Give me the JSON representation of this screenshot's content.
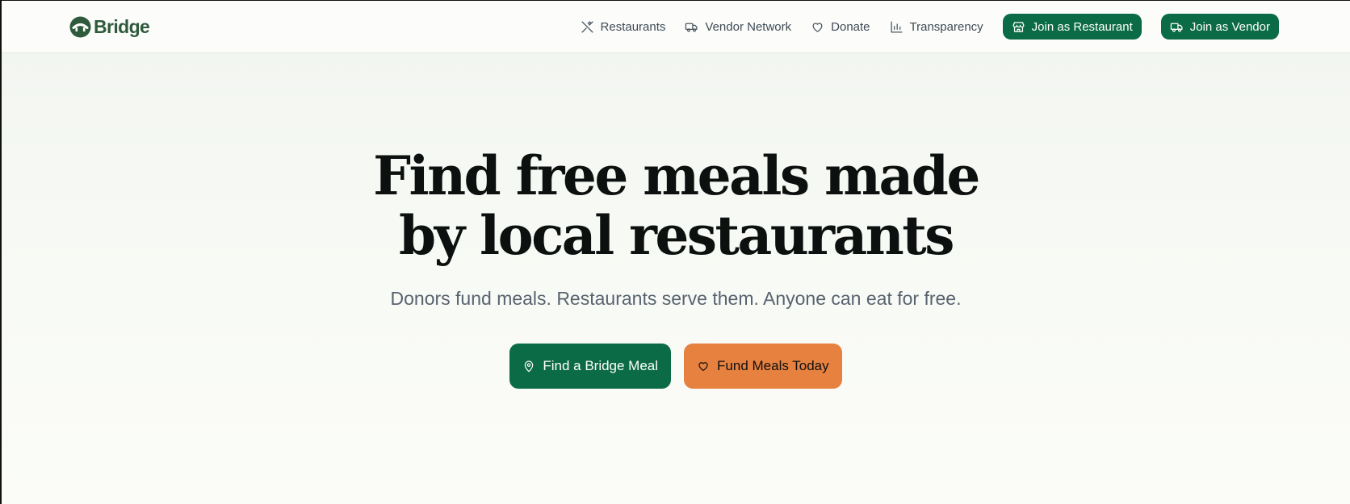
{
  "brand": {
    "name": "Bridge",
    "color": "#2f5a3c"
  },
  "nav": {
    "links": [
      {
        "label": "Restaurants",
        "icon": "utensils-crossed-icon"
      },
      {
        "label": "Vendor Network",
        "icon": "truck-icon"
      },
      {
        "label": "Donate",
        "icon": "heart-icon"
      },
      {
        "label": "Transparency",
        "icon": "bar-chart-icon"
      }
    ],
    "buttons": [
      {
        "label": "Join as Restaurant",
        "icon": "store-icon"
      },
      {
        "label": "Join as Vendor",
        "icon": "truck-icon"
      }
    ]
  },
  "hero": {
    "title_line1": "Find free meals made",
    "title_line2": "by local restaurants",
    "subtitle": "Donors fund meals. Restaurants serve them. Anyone can eat for free.",
    "primary_cta": {
      "label": "Find a Bridge Meal",
      "icon": "map-pin-icon"
    },
    "secondary_cta": {
      "label": "Fund Meals Today",
      "icon": "heart-icon"
    }
  },
  "colors": {
    "primary": "#0c6b47",
    "accent": "#e7813f",
    "heading": "#0c1110",
    "muted": "#58636f"
  }
}
